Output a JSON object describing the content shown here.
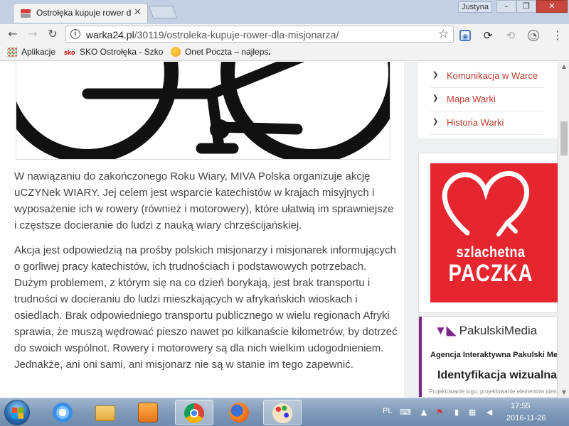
{
  "browser": {
    "tab_title": "Ostrołęka kupuje rower d",
    "tab_close": "✕",
    "user": "Justyna",
    "url_host": "warka24.pl",
    "url_path": "/30119/ostroleka-kupuje-rower-dla-misjonarza/",
    "bookmarks": [
      {
        "label": "Aplikacje"
      },
      {
        "label": "SKO Ostrołęka - Szkoł"
      },
      {
        "label": "Onet Poczta – najlepsza"
      }
    ]
  },
  "article": {
    "paragraphs": [
      "W nawiązaniu do zakończonego Roku Wiary, MIVA Polska organizuje akcję uCZYNek WIARY. Jej celem jest wsparcie katechistów w krajach misyjnych i wyposażenie ich w rowery (również i motorowery), które ułatwią im sprawniejsze i częstsze docieranie do ludzi z nauką wiary chrześcijańskiej.",
      "Akcja jest odpowiedzią na prośby polskich misjonarzy i misjonarek informujących o gorliwej pracy katechistów, ich trudnościach i podstawowych potrzebach. Dużym problemem, z którym się na co dzień borykają, jest brak transportu i trudności w docieraniu do ludzi mieszkających w afrykańskich wioskach i osiedlach. Brak odpowiedniego transportu publicznego w wielu regionach Afryki sprawia, że muszą wędrować pieszo nawet po kilkanaście kilometrów, by dotrzeć do swoich wspólnot. Rowery i motorowery są dla nich wielkim udogodnieniem. Jednakże, ani oni sami, ani misjonarz nie są w stanie im tego zapewnić."
    ]
  },
  "sidebar": {
    "links": [
      {
        "label": "Komunikacja w Warce"
      },
      {
        "label": "Mapa Warki"
      },
      {
        "label": "Historia Warki"
      }
    ],
    "ad1": {
      "line1": "szlachetna",
      "line2": "PACZKA"
    },
    "ad2": {
      "brand": "PakulskiMedia",
      "subtitle": "Agencja Interaktywna Pakulski Media",
      "headline": "Identyfikacja wizualna",
      "tiny": "Projektowanie logo, projektowanie elementów identyfikacji"
    }
  },
  "taskbar": {
    "lang": "PL",
    "time": "17:55",
    "date": "2016-11-26"
  },
  "colors": {
    "accent_link": "#c0392b",
    "ad_red": "#e6262e",
    "ad2_purple": "#7b2a8c"
  }
}
